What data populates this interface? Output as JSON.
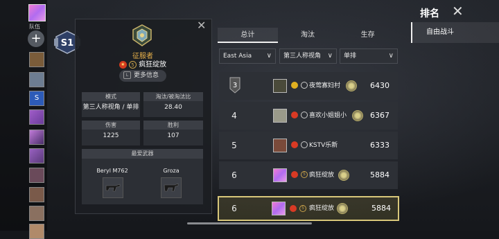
{
  "left_team": {
    "team_label": "队伍",
    "add_symbol": "+",
    "member_letter": "S",
    "season_badge": "S1"
  },
  "profile": {
    "title": "征服者",
    "level": "5",
    "name": "疯狂绽放",
    "more_info_key": "L",
    "more_info_label": "更多信息",
    "stats": [
      {
        "label": "模式",
        "value": "第三人称视角 / 单排"
      },
      {
        "label": "淘汰/被淘汰比",
        "value": "28.40"
      },
      {
        "label": "伤害",
        "value": "1225"
      },
      {
        "label": "胜利",
        "value": "107"
      }
    ],
    "weapons_label": "最爱武器",
    "weapons": [
      "Beryl M762",
      "Groza"
    ]
  },
  "tabs": [
    "总计",
    "淘汰",
    "生存"
  ],
  "filters": {
    "region": "East Asia",
    "perspective": "第三人称视角",
    "mode": "单排"
  },
  "leaderboard": [
    {
      "rank": "3",
      "name": "夜莺寡妇村",
      "score": "6430"
    },
    {
      "rank": "4",
      "name": "喜欢小姐姐小",
      "score": "6367"
    },
    {
      "rank": "5",
      "name": "KSTV乐新",
      "score": "6333"
    },
    {
      "rank": "6",
      "name": "疯狂绽放",
      "level": "5",
      "score": "5884"
    }
  ],
  "my_row": {
    "rank": "6",
    "name": "疯狂绽放",
    "level": "5",
    "score": "5884"
  },
  "right_panel": {
    "title": "排名",
    "menu_item": "自由战斗"
  },
  "colors": {
    "accent_gold": "#e7b04a",
    "highlight_border": "#d8c77a",
    "badge_red": "#d23a1e"
  }
}
